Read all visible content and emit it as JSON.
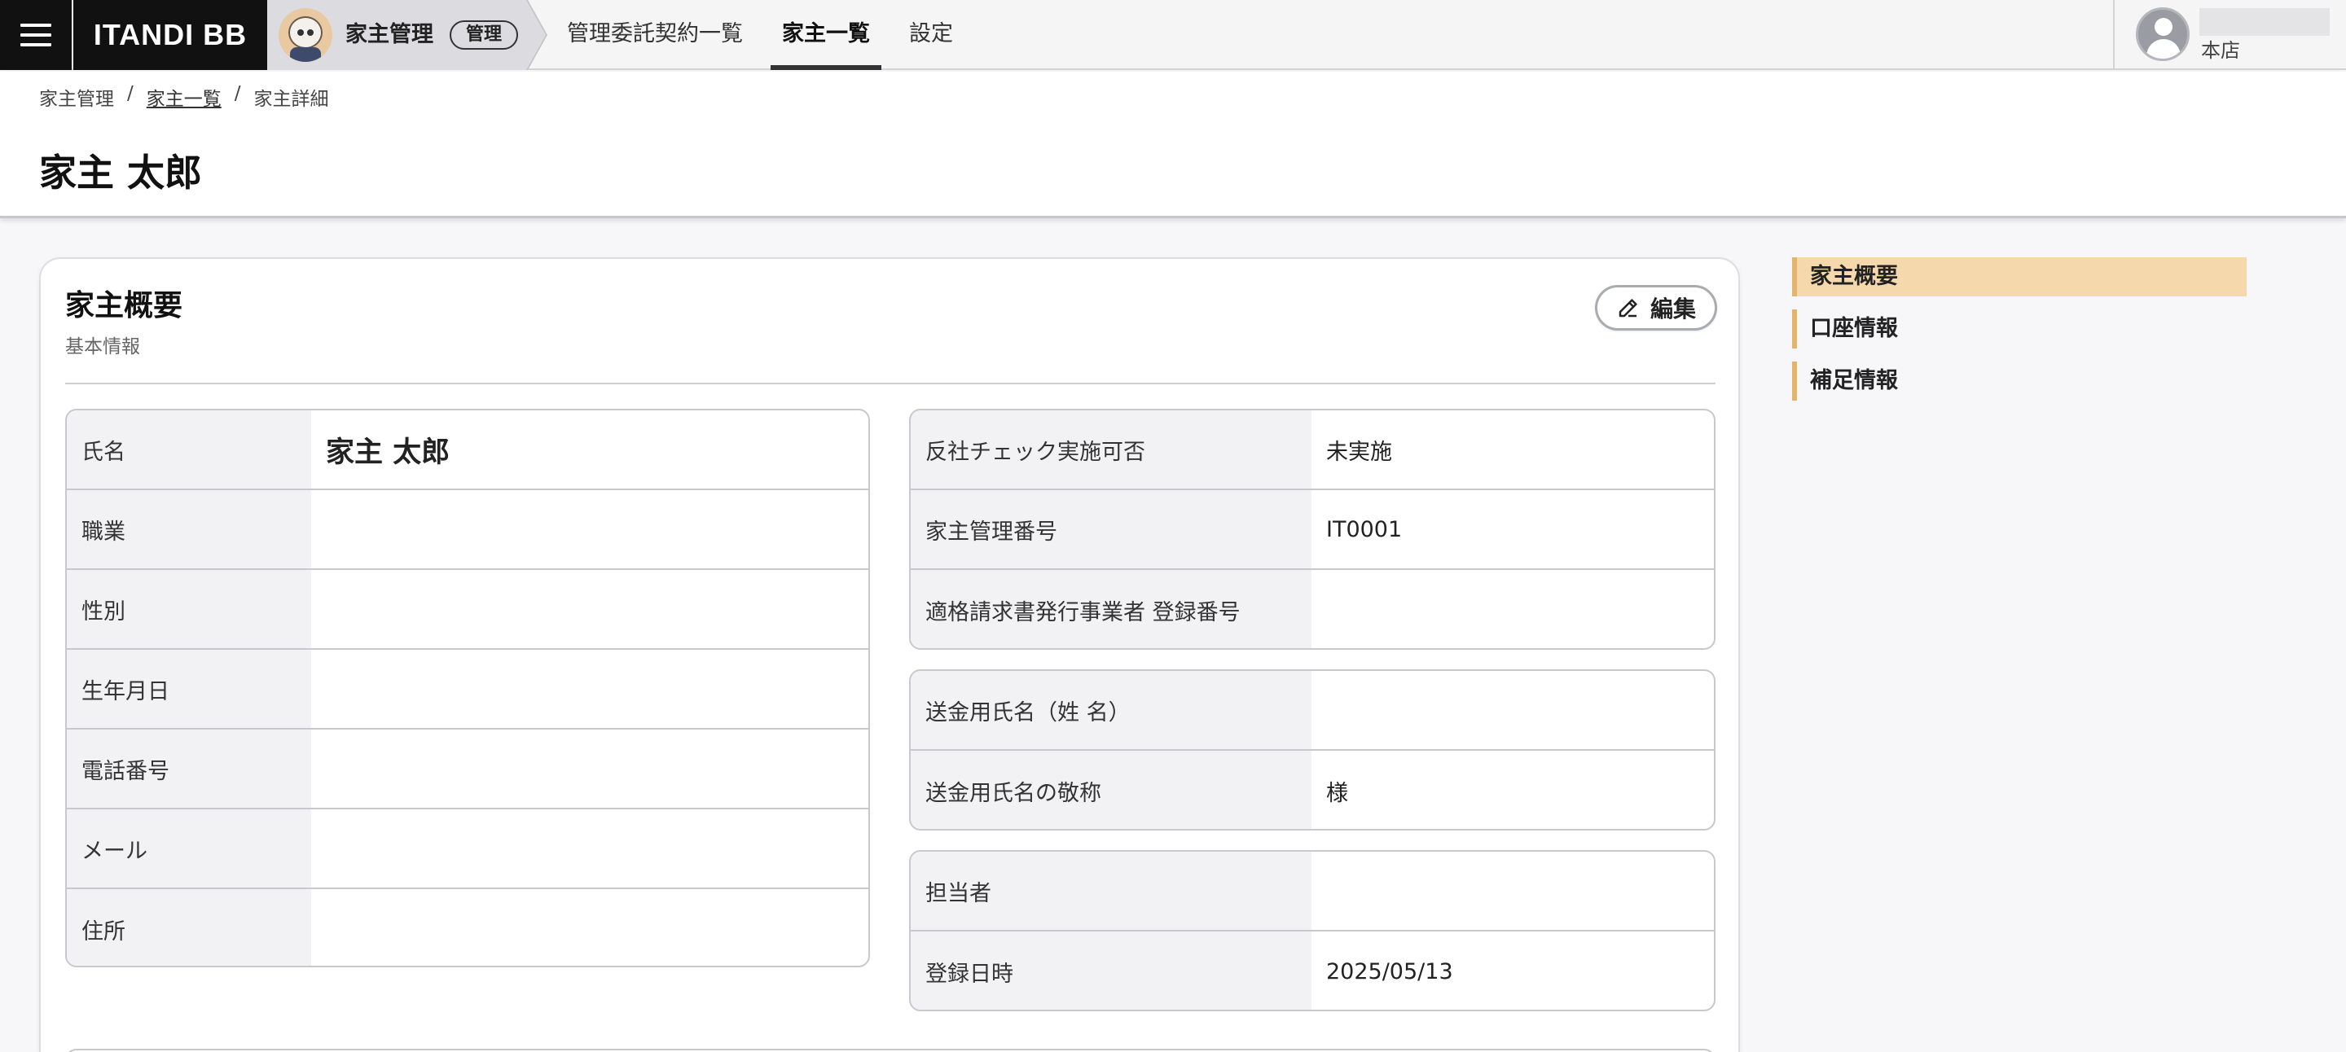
{
  "topbar": {
    "logo": "ITANDI BB",
    "app_name": "家主管理",
    "app_badge": "管理",
    "nav": [
      {
        "label": "管理委託契約一覧",
        "active": false
      },
      {
        "label": "家主一覧",
        "active": true
      },
      {
        "label": "設定",
        "active": false
      }
    ],
    "user": {
      "branch": "本店"
    }
  },
  "breadcrumb": {
    "items": [
      "家主管理",
      "家主一覧",
      "家主詳細"
    ],
    "separator": "/"
  },
  "page_title": "家主 太郎",
  "card": {
    "title": "家主概要",
    "subtitle": "基本情報",
    "edit_label": "編集"
  },
  "left_table": [
    {
      "label": "氏名",
      "value": "家主 太郎"
    },
    {
      "label": "職業",
      "value": ""
    },
    {
      "label": "性別",
      "value": ""
    },
    {
      "label": "生年月日",
      "value": ""
    },
    {
      "label": "電話番号",
      "value": ""
    },
    {
      "label": "メール",
      "value": ""
    },
    {
      "label": "住所",
      "value": ""
    }
  ],
  "right_table_1": [
    {
      "label": "反社チェック実施可否",
      "value": "未実施"
    },
    {
      "label": "家主管理番号",
      "value": "IT0001"
    },
    {
      "label": "適格請求書発行事業者 登録番号",
      "value": ""
    }
  ],
  "right_table_2": [
    {
      "label": "送金用氏名（姓 名）",
      "value": ""
    },
    {
      "label": "送金用氏名の敬称",
      "value": "様"
    }
  ],
  "right_table_3": [
    {
      "label": "担当者",
      "value": ""
    },
    {
      "label": "登録日時",
      "value": "2025/05/13"
    }
  ],
  "side_nav": [
    {
      "label": "家主概要",
      "active": true
    },
    {
      "label": "口座情報",
      "active": false
    },
    {
      "label": "補足情報",
      "active": false
    }
  ],
  "colors": {
    "accent": "#e3b46a",
    "accent_bg": "#f5d9ad",
    "header_dark": "#111111"
  },
  "icons": {
    "menu": "hamburger-icon",
    "edit": "pencil-icon",
    "user": "user-avatar-icon",
    "mascot": "mascot-logo"
  }
}
